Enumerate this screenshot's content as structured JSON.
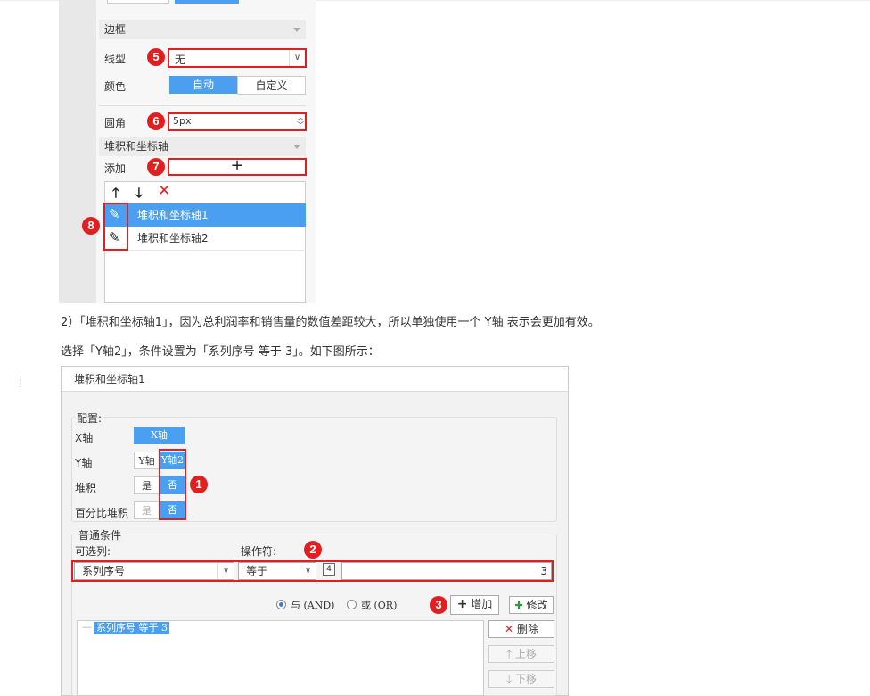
{
  "top_panel": {
    "section_border": "边框",
    "line_type_label": "线型",
    "line_type_value": "无",
    "color_label": "颜色",
    "color_auto": "自动",
    "color_custom": "自定义",
    "radius_label": "圆角",
    "radius_value": "5px",
    "section_axis": "堆积和坐标轴",
    "add_label": "添加",
    "add_symbol": "+",
    "axis_items": [
      "堆积和坐标轴1",
      "堆积和坐标轴2"
    ],
    "badges": [
      "5",
      "6",
      "7",
      "8"
    ]
  },
  "paragraphs": {
    "p1": "2）「堆积和坐标轴1」，因为总利润率和销售量的数值差距较大，所以单独使用一个 Y轴 表示会更加有效。",
    "p2": "选择「Y轴2」，条件设置为「系列序号 等于 3」。如下图所示："
  },
  "dialog": {
    "title": "堆积和坐标轴1",
    "config_group": "配置:",
    "x_axis_label": "X轴",
    "x_axis_value": "X轴",
    "y_axis_label": "Y轴",
    "y_axis_opt1": "Y轴",
    "y_axis_opt2": "Y轴2",
    "stack_label": "堆积",
    "stack_yes": "是",
    "stack_no": "否",
    "pct_stack_label": "百分比堆积",
    "pct_yes": "是",
    "pct_no": "否",
    "cond_group": "普通条件",
    "col_label": "可选列:",
    "op_label": "操作符:",
    "col_value": "系列序号",
    "op_value": "等于",
    "type_icon": "4",
    "cond_value": "3",
    "radio_and": "与 (AND)",
    "radio_or": "或 (OR)",
    "add_btn": "增加",
    "modify_btn": "修改",
    "delete_btn": "删除",
    "up_btn": "上移",
    "down_btn": "下移",
    "result_item": "系列序号 等于 3",
    "badges": [
      "1",
      "2",
      "3"
    ]
  }
}
